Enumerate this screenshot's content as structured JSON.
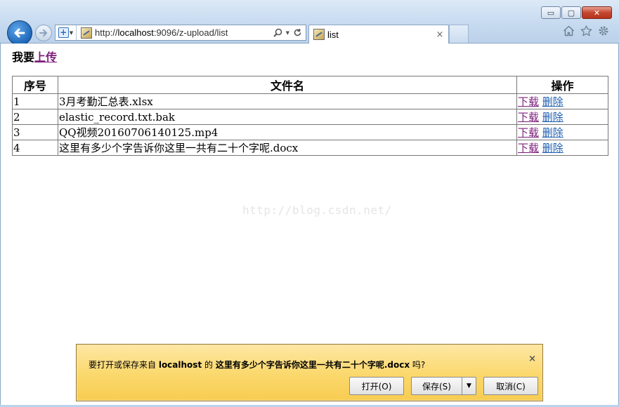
{
  "browser": {
    "url_prefix": "http://",
    "url_host": "localhost",
    "url_rest": ":9096/z-upload/list",
    "tab_title": "list",
    "tab_close": "×",
    "window_controls": {
      "minimize": "▭",
      "maximize": "▢",
      "close": "✕"
    }
  },
  "page": {
    "upload_prefix": "我要",
    "upload_link": "上传",
    "table": {
      "headers": {
        "no": "序号",
        "name": "文件名",
        "action": "操作"
      },
      "rows": [
        {
          "no": "1",
          "name": "3月考勤汇总表.xlsx",
          "download": "下载",
          "delete": "删除"
        },
        {
          "no": "2",
          "name": "elastic_record.txt.bak",
          "download": "下载",
          "delete": "删除"
        },
        {
          "no": "3",
          "name": "QQ视频20160706140125.mp4",
          "download": "下载",
          "delete": "删除"
        },
        {
          "no": "4",
          "name": "这里有多少个字告诉你这里一共有二十个字呢.docx",
          "download": "下载",
          "delete": "删除"
        }
      ]
    },
    "watermark": "http://blog.csdn.net/"
  },
  "notification": {
    "msg_1": "要打开或保存来自 ",
    "host": "localhost",
    "msg_2": " 的 ",
    "filename": "这里有多少个字告诉你这里一共有二十个字呢.docx",
    "msg_3": " 吗?",
    "close": "×",
    "open_label": "打开(O)",
    "save_label": "保存(S)",
    "save_dropdown": "▼",
    "cancel_label": "取消(C)"
  }
}
